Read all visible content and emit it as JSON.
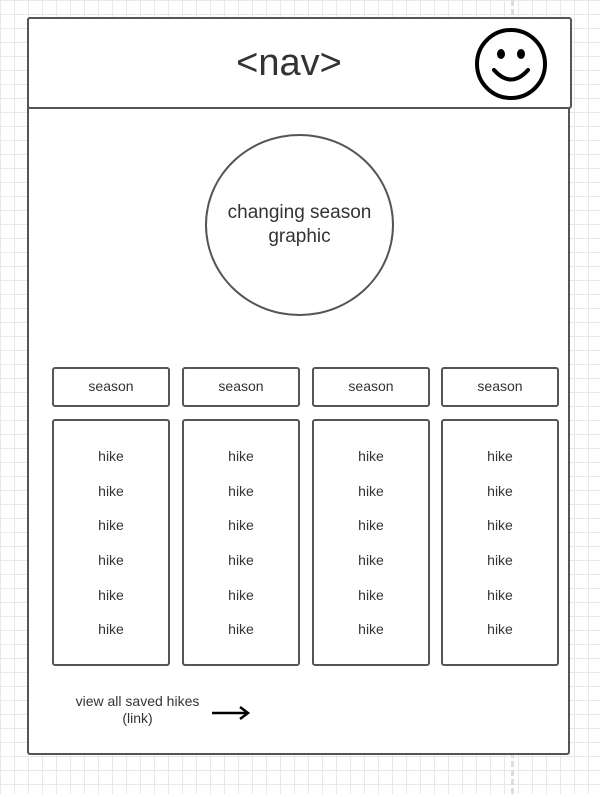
{
  "nav": {
    "label": "<nav>",
    "profile_icon": "smiley-face-icon"
  },
  "hero": {
    "graphic_label": "changing season graphic"
  },
  "seasons": [
    {
      "label": "season",
      "hikes": [
        "hike",
        "hike",
        "hike",
        "hike",
        "hike",
        "hike"
      ]
    },
    {
      "label": "season",
      "hikes": [
        "hike",
        "hike",
        "hike",
        "hike",
        "hike",
        "hike"
      ]
    },
    {
      "label": "season",
      "hikes": [
        "hike",
        "hike",
        "hike",
        "hike",
        "hike",
        "hike"
      ]
    },
    {
      "label": "season",
      "hikes": [
        "hike",
        "hike",
        "hike",
        "hike",
        "hike",
        "hike"
      ]
    }
  ],
  "footer": {
    "link_line1": "view all saved hikes",
    "link_line2": "(link)",
    "arrow_icon": "arrow-right-icon"
  },
  "colors": {
    "stroke": "#555555",
    "text": "#333333",
    "grid": "#e8e8e8"
  }
}
